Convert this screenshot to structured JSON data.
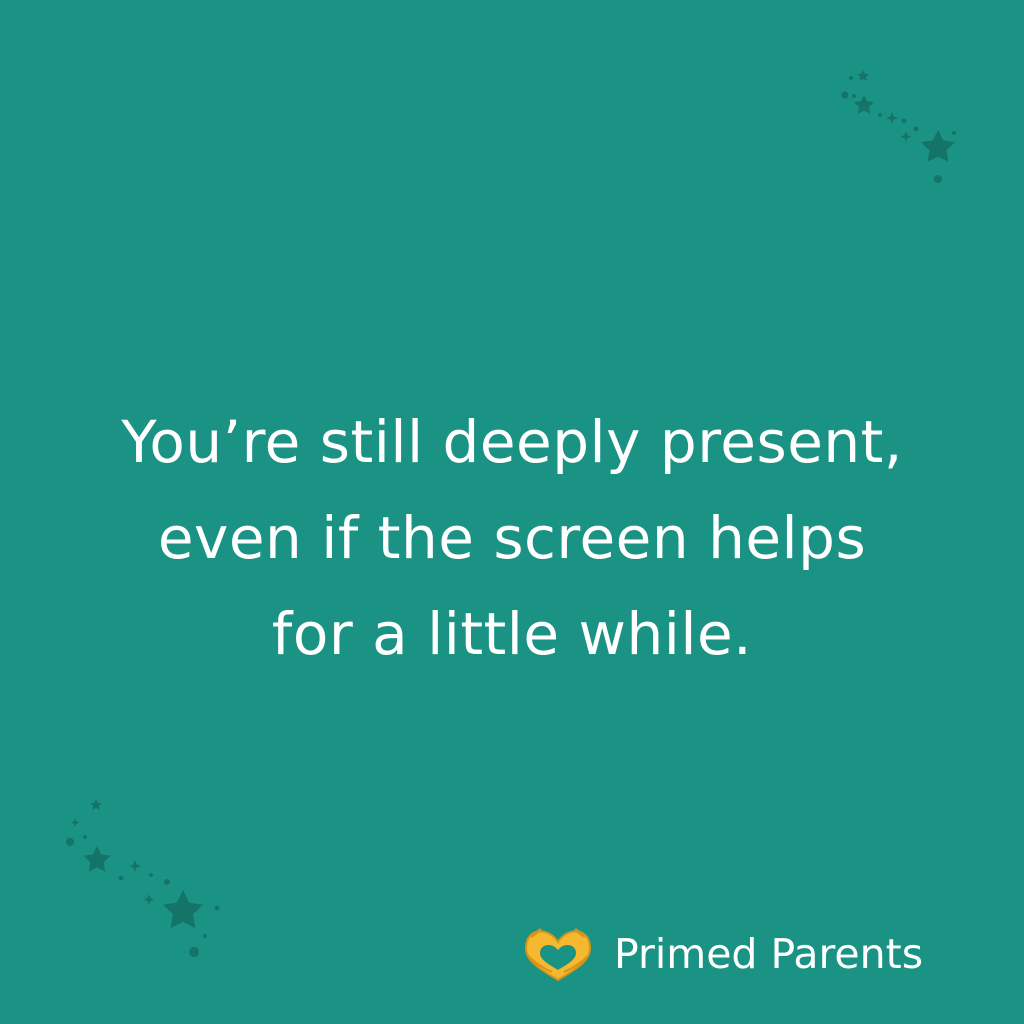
{
  "quote": {
    "lines": [
      "You’re still deeply present,",
      "even if the screen helps",
      "for a little while."
    ]
  },
  "brand": {
    "name": "Primed Parents",
    "icon": "heart-hands-icon"
  },
  "decorations": {
    "top_right": "star-cluster-icon",
    "bottom_left": "star-cluster-icon"
  },
  "colors": {
    "background": "#1a9385",
    "text": "#ffffff",
    "stars": "#157468",
    "heart_hands": "#f5b82e"
  }
}
